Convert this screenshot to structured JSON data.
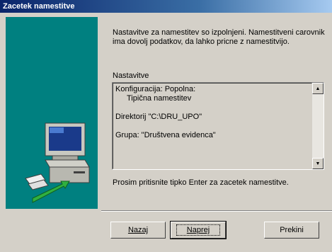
{
  "window": {
    "title": "Zacetek namestitve"
  },
  "intro_text": "Nastavitve za namestitev so izpolnjeni. Namestitveni carovnik ima dovolj podatkov, da lahko pricne z namestitvijo.",
  "settings": {
    "label": "Nastavitve",
    "lines": {
      "config": "Konfiguracija: Popolna:",
      "config_sub": "Tipična namestitev",
      "directory": "Direktorij \"C:\\DRU_UPO\"",
      "group": "Grupa: \"Društvena evidenca\""
    }
  },
  "footer_note": "Prosim pritisnite tipko Enter za zacetek namestitve.",
  "buttons": {
    "back": "Nazaj",
    "next": "Naprej",
    "cancel": "Prekini"
  },
  "colors": {
    "panel": "#008080",
    "titlebar": "#0a246a",
    "face": "#d4d0c8"
  },
  "icons": {
    "illustration": "computer-install-icon",
    "scroll_up": "arrow-up-icon",
    "scroll_down": "arrow-down-icon"
  }
}
